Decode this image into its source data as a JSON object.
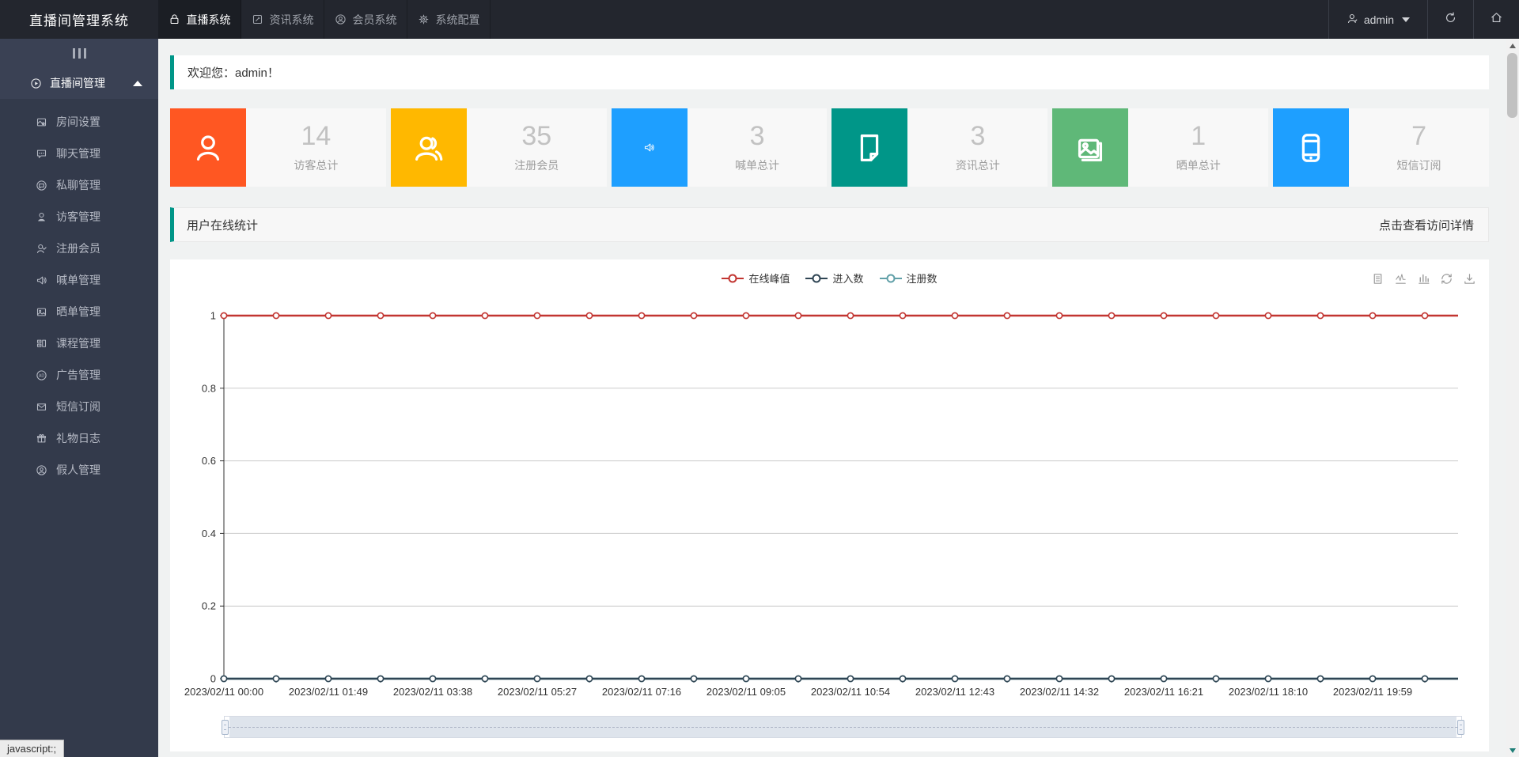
{
  "app": {
    "title": "直播间管理系统"
  },
  "header": {
    "tabs": [
      {
        "label": "直播系统",
        "icon": "live-system-icon",
        "active": true
      },
      {
        "label": "资讯系统",
        "icon": "news-system-icon",
        "active": false
      },
      {
        "label": "会员系统",
        "icon": "member-system-icon",
        "active": false
      },
      {
        "label": "系统配置",
        "icon": "system-config-icon",
        "active": false
      }
    ],
    "user": {
      "name": "admin"
    }
  },
  "sidebar": {
    "parent_menu": {
      "label": "直播间管理",
      "icon": "play-circle-icon",
      "expanded": true
    },
    "items": [
      {
        "label": "房间设置",
        "icon": "room-settings-icon"
      },
      {
        "label": "聊天管理",
        "icon": "chat-icon"
      },
      {
        "label": "私聊管理",
        "icon": "private-chat-icon"
      },
      {
        "label": "访客管理",
        "icon": "visitor-icon"
      },
      {
        "label": "注册会员",
        "icon": "register-member-icon"
      },
      {
        "label": "喊单管理",
        "icon": "speaker-icon"
      },
      {
        "label": "晒单管理",
        "icon": "photo-icon"
      },
      {
        "label": "课程管理",
        "icon": "course-icon"
      },
      {
        "label": "广告管理",
        "icon": "ad-icon"
      },
      {
        "label": "短信订阅",
        "icon": "sms-icon"
      },
      {
        "label": "礼物日志",
        "icon": "gift-icon"
      },
      {
        "label": "假人管理",
        "icon": "dummy-user-icon"
      }
    ]
  },
  "welcome": {
    "text": "欢迎您：admin！"
  },
  "stats": [
    {
      "value": "14",
      "label": "访客总计",
      "color": "#FF5722",
      "icon": "person-icon"
    },
    {
      "value": "35",
      "label": "注册会员",
      "color": "#FFB800",
      "icon": "people-icon"
    },
    {
      "value": "3",
      "label": "喊单总计",
      "color": "#1E9FFF",
      "icon": "speaker-icon"
    },
    {
      "value": "3",
      "label": "资讯总计",
      "color": "#009688",
      "icon": "document-icon"
    },
    {
      "value": "1",
      "label": "晒单总计",
      "color": "#5FB878",
      "icon": "photos-icon"
    },
    {
      "value": "7",
      "label": "短信订阅",
      "color": "#1E9FFF",
      "icon": "phone-icon"
    }
  ],
  "panel": {
    "title": "用户在线统计",
    "link": "点击查看访问详情",
    "accent_color": "#009688"
  },
  "chart_data": {
    "type": "line",
    "title": "用户在线统计",
    "x_labels": [
      "2023/02/11 00:00",
      "2023/02/11 01:49",
      "2023/02/11 03:38",
      "2023/02/11 05:27",
      "2023/02/11 07:16",
      "2023/02/11 09:05",
      "2023/02/11 10:54",
      "2023/02/11 12:43",
      "2023/02/11 14:32",
      "2023/02/11 16:21",
      "2023/02/11 18:10",
      "2023/02/11 19:59"
    ],
    "label_every_n_points": 2,
    "points_per_series": 24,
    "series": [
      {
        "name": "在线峰值",
        "color": "#c23531",
        "values": [
          1,
          1,
          1,
          1,
          1,
          1,
          1,
          1,
          1,
          1,
          1,
          1,
          1,
          1,
          1,
          1,
          1,
          1,
          1,
          1,
          1,
          1,
          1,
          1
        ]
      },
      {
        "name": "进入数",
        "color": "#2f4554",
        "values": [
          0,
          0,
          0,
          0,
          0,
          0,
          0,
          0,
          0,
          0,
          0,
          0,
          0,
          0,
          0,
          0,
          0,
          0,
          0,
          0,
          0,
          0,
          0,
          0
        ]
      },
      {
        "name": "注册数",
        "color": "#61a0a8",
        "values": [
          0,
          0,
          0,
          0,
          0,
          0,
          0,
          0,
          0,
          0,
          0,
          0,
          0,
          0,
          0,
          0,
          0,
          0,
          0,
          0,
          0,
          0,
          0,
          0
        ]
      }
    ],
    "y_ticks": [
      0,
      0.2,
      0.4,
      0.6,
      0.8,
      1
    ],
    "ylim": [
      0,
      1
    ],
    "grid": true,
    "legend_position": "top-center",
    "toolbox": [
      "data-view-icon",
      "line-chart-icon",
      "bar-chart-icon",
      "restore-icon",
      "save-image-icon"
    ],
    "data_zoom": {
      "start": 0,
      "end": 100
    }
  },
  "status_bar": {
    "text": "javascript:;"
  }
}
